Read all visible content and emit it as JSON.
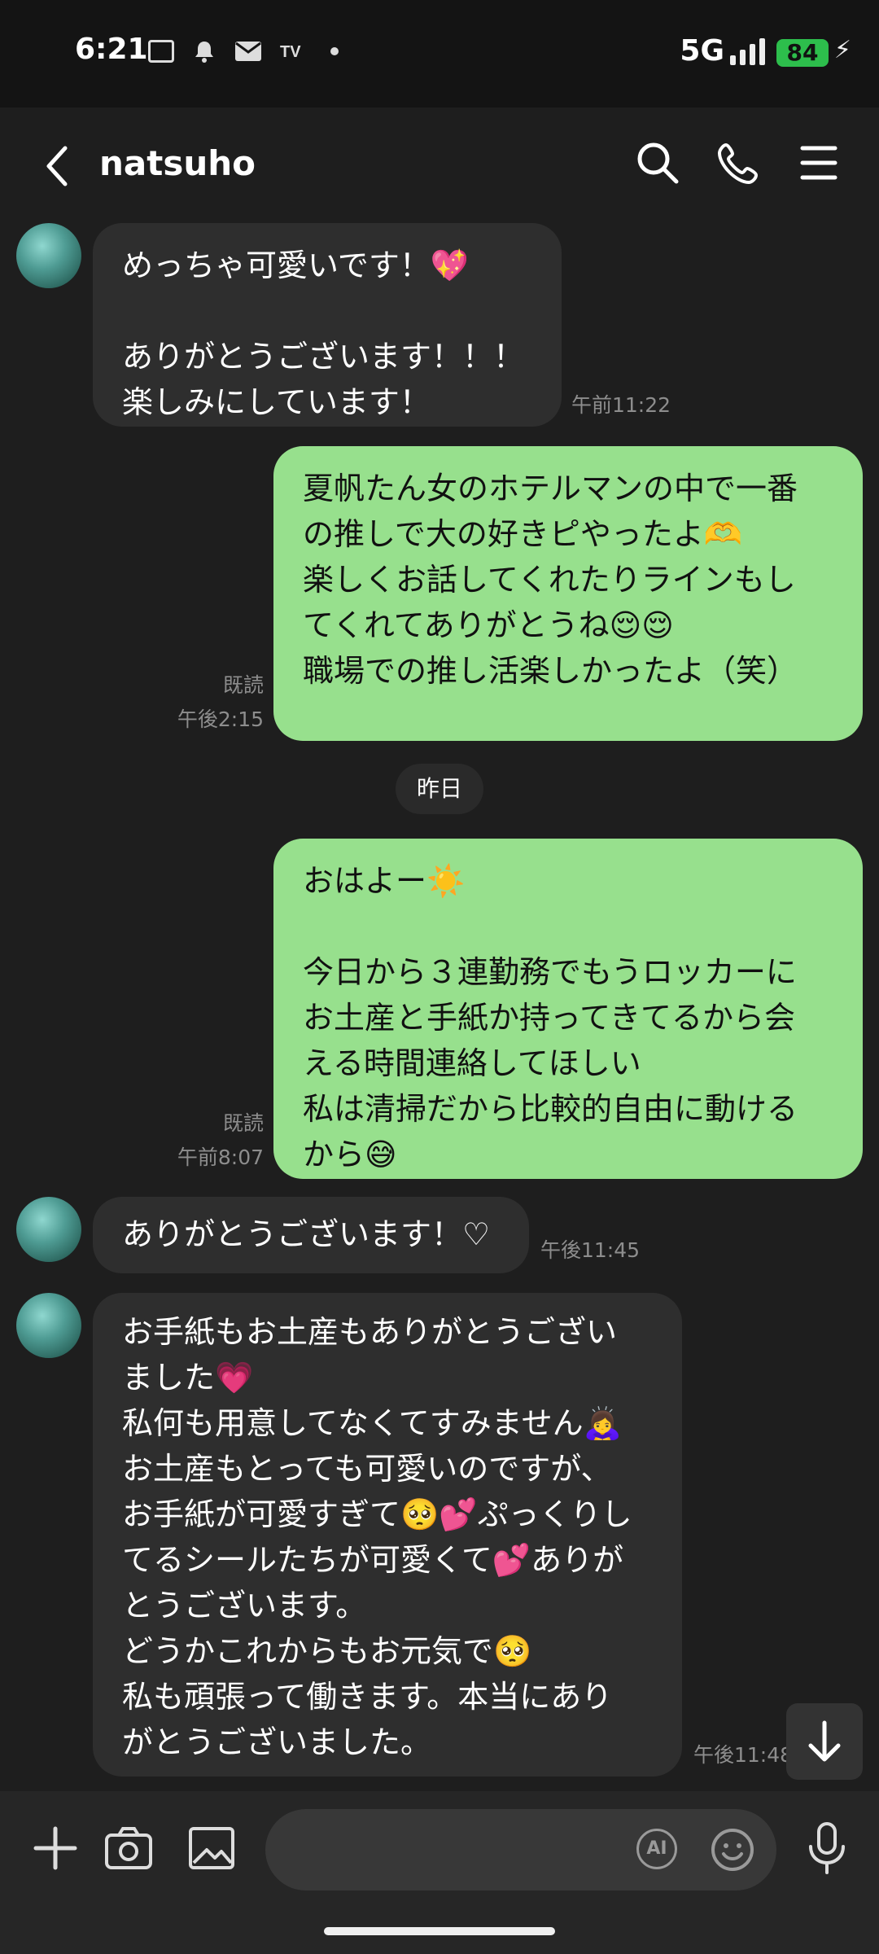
{
  "status_bar": {
    "time": "6:21",
    "icons": [
      "notification-icon",
      "au-icon",
      "bell-icon",
      "mail-icon",
      "tver-icon"
    ],
    "network": "5G",
    "battery": "84"
  },
  "header": {
    "title": "natsuho",
    "icons": [
      "back-icon",
      "search-icon",
      "phone-icon",
      "menu-icon"
    ]
  },
  "messages": [
    {
      "side": "received",
      "text": "めっちゃ可愛いです！💖\n\nありがとうございます！！！\n楽しみにしています！",
      "time": "午前11:22"
    },
    {
      "side": "sent",
      "text": "夏帆たん女のホテルマンの中で一番\nの推しで大の好きピやったよ🫶\n楽しくお話してくれたりラインもし\nてくれてありがとうね😌😌\n職場での推し活楽しかったよ（笑）",
      "read": "既読",
      "time": "午後2:15"
    },
    {
      "side": "sent",
      "text": "おはよー☀️\n\n今日から３連勤務でもうロッカーに\nお土産と手紙か持ってきてるから会\nえる時間連絡してほしい\n私は清掃だから比較的自由に動ける\nから😅",
      "read": "既読",
      "time": "午前8:07"
    },
    {
      "side": "received",
      "text": "ありがとうございます！♡",
      "time": "午後11:45"
    },
    {
      "side": "received",
      "text": "お手紙もお土産もありがとうござい\nました💗\n私何も用意してなくてすみません🙇‍♀️\nお土産もとっても可愛いのですが、\nお手紙が可愛すぎて🥺💕ぷっくりし\nてるシールたちが可愛くて💕ありが\nとうございます。\nどうかこれからもお元気で🥺\n私も頑張って働きます。本当にあり\nがとうございました。",
      "time": "午後11:48"
    }
  ],
  "date_separator": "昨日",
  "input_bar": {
    "ai_label": "AI",
    "icons": [
      "plus-icon",
      "camera-icon",
      "image-icon",
      "ai-icon",
      "emoji-icon",
      "mic-icon"
    ]
  },
  "colors": {
    "background": "#1e1e1e",
    "sent_bubble": "#97e08d",
    "received_bubble": "#2e2e2e",
    "battery": "#2dbe4c"
  }
}
